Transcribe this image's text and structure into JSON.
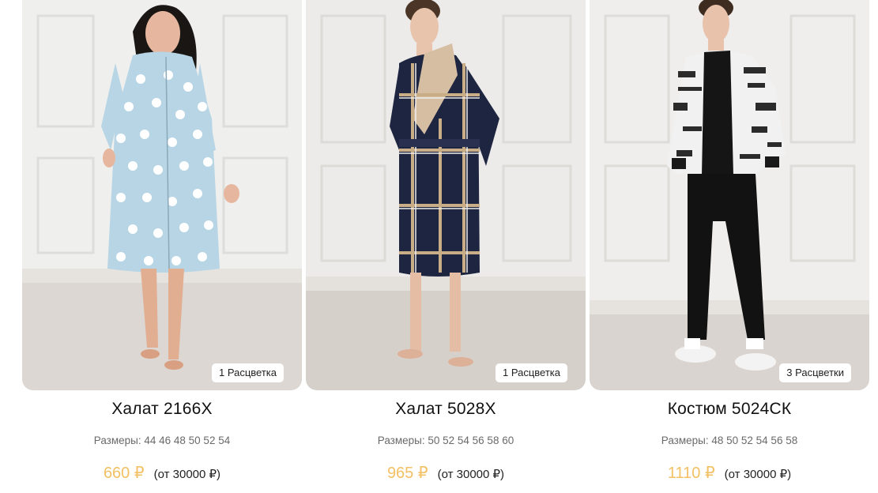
{
  "products": [
    {
      "title": "Халат 2166Х",
      "sizes": "Размеры: 44 46 48 50 52 54",
      "price": "660 ₽",
      "wholesale": "(от 30000 ₽)",
      "colors_badge": "1 Расцветка",
      "image": "woman-in-light-blue-polka-dot-robe"
    },
    {
      "title": "Халат 5028Х",
      "sizes": "Размеры: 50 52 54 56 58 60",
      "price": "965 ₽",
      "wholesale": "(от 30000 ₽)",
      "colors_badge": "1 Расцветка",
      "image": "man-in-navy-plaid-robe"
    },
    {
      "title": "Костюм 5024СК",
      "sizes": "Размеры: 48 50 52 54 56 58",
      "price": "1110 ₽",
      "wholesale": "(от 30000 ₽)",
      "colors_badge": "3 Расцветки",
      "image": "man-in-newsprint-jacket-and-black-joggers"
    }
  ],
  "colors": {
    "price": "#f3c064",
    "title": "#111111",
    "sizes": "#6a6a6a",
    "badge_bg": "#ffffff"
  }
}
